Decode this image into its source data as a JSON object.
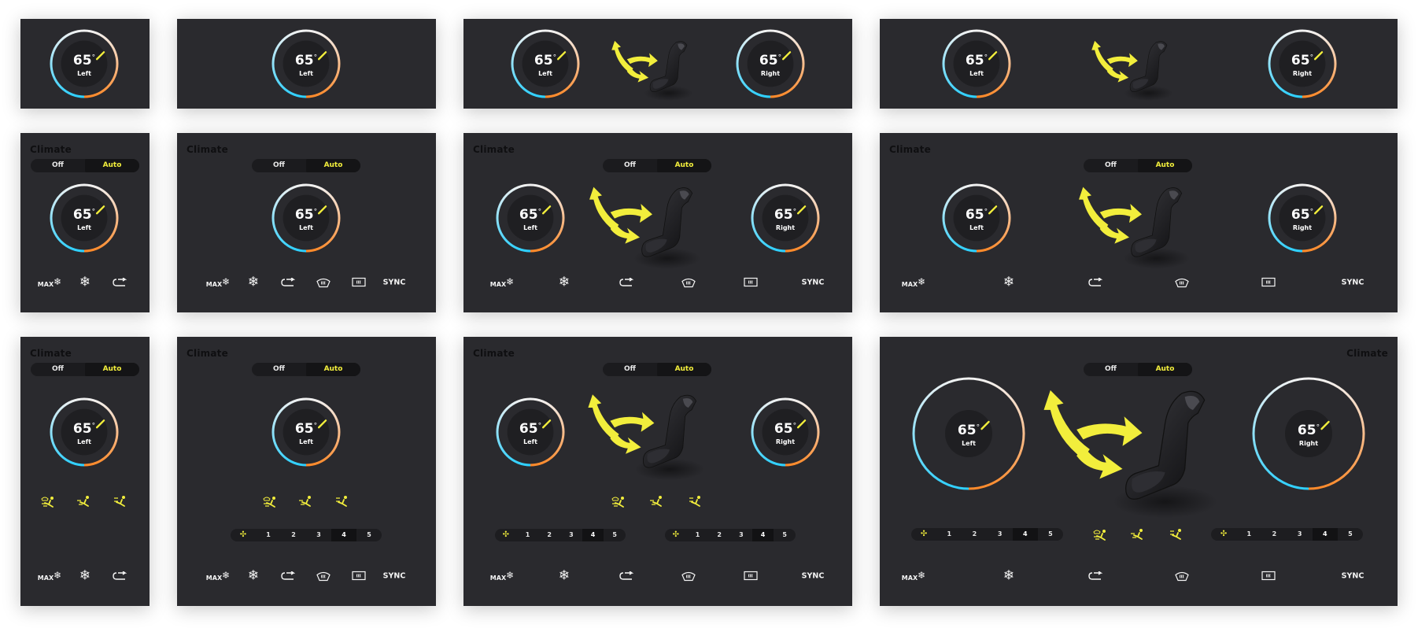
{
  "ui": {
    "title": "Climate",
    "off": "Off",
    "auto": "Auto",
    "temp": "65",
    "deg": "°",
    "left": "Left",
    "right": "Right",
    "max_label": "MAX",
    "snow_glyph": "❄",
    "sync": "SYNC",
    "fan_icon": "✣",
    "fan_levels": [
      "1",
      "2",
      "3",
      "4",
      "5"
    ],
    "fan_selected": "4"
  },
  "colors": {
    "panel": "#2a2a2e",
    "accent_yellow": "#f2ee3c",
    "dial_cool": "#2ed0ff",
    "dial_warm": "#ff8a2a",
    "text": "#f4f4f4"
  }
}
